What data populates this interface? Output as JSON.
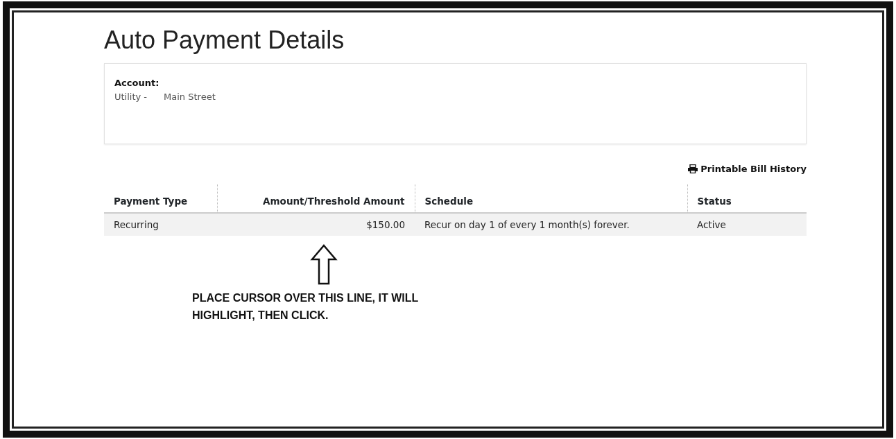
{
  "page": {
    "title": "Auto Payment Details"
  },
  "account": {
    "label": "Account:",
    "type": "Utility -",
    "name": "Main Street"
  },
  "print_link": {
    "label": "Printable Bill History"
  },
  "table": {
    "columns": [
      {
        "label": "Payment Type",
        "kind": "text"
      },
      {
        "label": "Amount/Threshold Amount",
        "kind": "amount"
      },
      {
        "label": "Schedule",
        "kind": "text"
      },
      {
        "label": "Status",
        "kind": "text"
      }
    ],
    "rows": [
      {
        "cells": [
          "Recurring",
          "$150.00",
          "Recur on day 1 of every 1 month(s) forever.",
          "Active"
        ],
        "highlighted": true
      }
    ]
  },
  "annotation": {
    "text": "PLACE CURSOR OVER THIS LINE, IT WILL HIGHLIGHT, THEN CLICK."
  }
}
